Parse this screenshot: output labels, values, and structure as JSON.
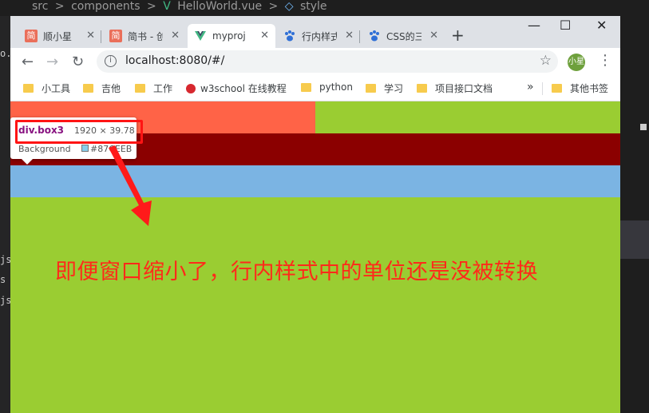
{
  "editor": {
    "breadcrumb": [
      "src",
      ">",
      "components",
      ">",
      "HelloWorld.vue",
      ">",
      "style"
    ],
    "left_fragments": [
      "o...",
      "js",
      "s",
      "js"
    ]
  },
  "browser": {
    "tabs": [
      {
        "title": "顺小星",
        "favicon": "简",
        "active": false
      },
      {
        "title": "简书 - 创",
        "favicon": "简",
        "active": false
      },
      {
        "title": "myproj",
        "favicon": "vue-icon",
        "active": true
      },
      {
        "title": "行内样式",
        "favicon": "paw-icon",
        "active": false
      },
      {
        "title": "CSS的三",
        "favicon": "paw-icon",
        "active": false
      }
    ],
    "new_tab_label": "+",
    "window_controls": {
      "minimize": "—",
      "maximize": "☐",
      "close": "✕"
    },
    "url": "localhost:8080/#/",
    "profile_label": "小星",
    "bookmarks": [
      {
        "label": "小工具",
        "icon": "folder"
      },
      {
        "label": "吉他",
        "icon": "folder"
      },
      {
        "label": "工作",
        "icon": "folder"
      },
      {
        "label": "w3school 在线教程",
        "icon": "w3school"
      },
      {
        "label": "python",
        "icon": "folder"
      },
      {
        "label": "学习",
        "icon": "folder"
      },
      {
        "label": "项目接口文档",
        "icon": "folder"
      }
    ],
    "bookmarks_more": "»",
    "other_bookmarks": "其他书签"
  },
  "page": {
    "tooltip": {
      "selector": "div.box3",
      "size": "1920 × 39.78",
      "bg_label": "Background",
      "bg_value": "#87CEEB"
    },
    "annotation": "即便窗口缩小了，行内样式中的单位还是没被转换"
  },
  "colors": {
    "box1": "#ff6347",
    "box2": "#8b0000",
    "box3": "#87ceeb",
    "page_bg": "#9acd32",
    "annotation": "#ff2a1a"
  }
}
